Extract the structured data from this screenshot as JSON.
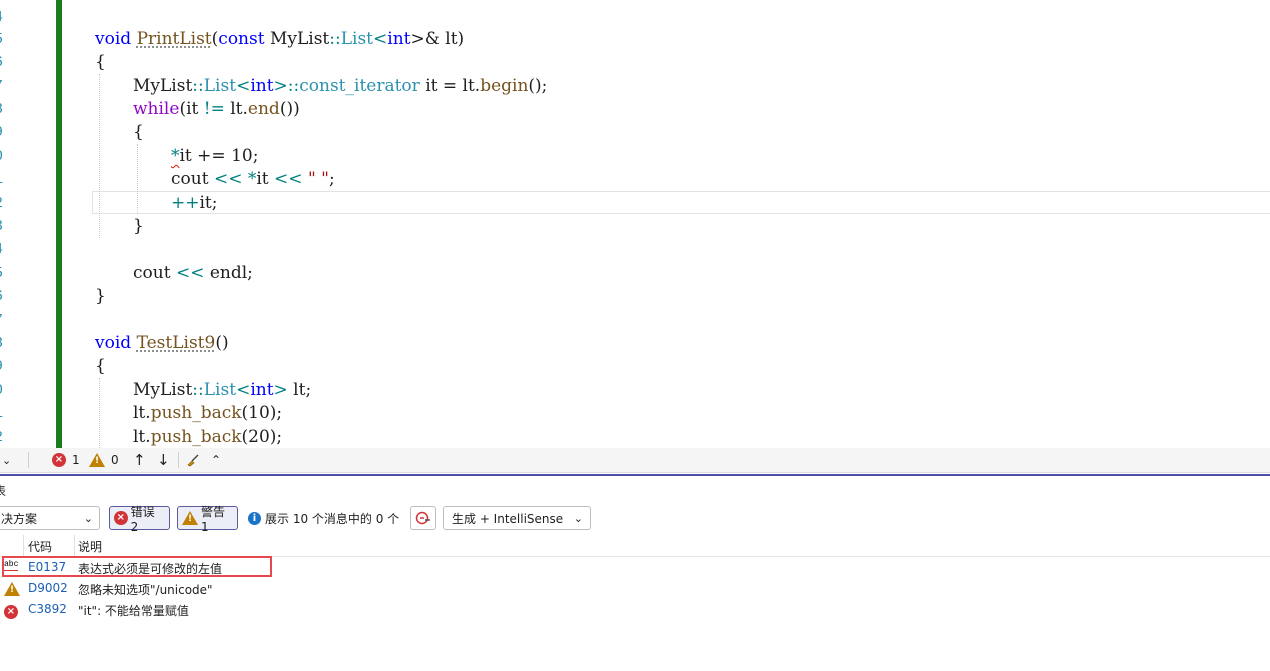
{
  "editor": {
    "line_numbers": [
      "4",
      "5",
      "6",
      "7",
      "8",
      "9",
      "0",
      "1",
      "2",
      "3",
      "4",
      "5",
      "6",
      "7",
      "8",
      "9",
      "0",
      "1",
      "2"
    ],
    "code": {
      "l1": [
        "void",
        " ",
        "PrintList",
        "(",
        "const",
        " MyList",
        "::",
        "List",
        "<",
        "int",
        ">& lt)"
      ],
      "l2": "{",
      "l3": [
        "MyList",
        "::",
        "List",
        "<",
        "int",
        ">",
        "::",
        "const_iterator",
        " it = lt.",
        "begin",
        "();"
      ],
      "l4": [
        "while",
        "(it ",
        "!=",
        " lt.",
        "end",
        "())"
      ],
      "l5": "{",
      "l6": [
        "*",
        "it += 10;"
      ],
      "l7": [
        "cout ",
        "<<",
        " ",
        "*",
        "it ",
        "<<",
        " ",
        "\" \"",
        ";"
      ],
      "l8": [
        "++",
        "it;"
      ],
      "l9": "}",
      "l10": [
        "cout ",
        "<<",
        " endl;"
      ],
      "l11": "}",
      "l12": [
        "void",
        " ",
        "TestList9",
        "()"
      ],
      "l13": "{",
      "l14": [
        "MyList",
        "::",
        "List",
        "<",
        "int",
        ">",
        " lt;"
      ],
      "l15": [
        "lt.",
        "push_back",
        "(10);"
      ],
      "l16": [
        "lt.",
        "push_back",
        "(20);"
      ]
    }
  },
  "statusbar": {
    "errors": "1",
    "warnings": "0",
    "up_icon": "arrow-up-icon",
    "down_icon": "arrow-down-icon",
    "broom_icon": "broom-icon",
    "caret_icon": "caret-up-icon"
  },
  "panel": {
    "title": "表",
    "scope_select": "决方案",
    "errors_btn": "错误 2",
    "warnings_btn": "警告 1",
    "messages_btn": "展示 10 个消息中的 0 个",
    "build_select": "生成 + IntelliSense"
  },
  "grid": {
    "columns": [
      "代码",
      "说明"
    ],
    "rows": [
      {
        "icon": "intellisense-abc-icon",
        "code": "E0137",
        "description": "表达式必须是可修改的左值"
      },
      {
        "icon": "warning-icon",
        "code": "D9002",
        "description": "忽略未知选项\"/unicode\""
      },
      {
        "icon": "error-icon",
        "code": "C3892",
        "description": "\"it\": 不能给常量赋值"
      }
    ]
  },
  "colors": {
    "change_bar": "#1e7a1e",
    "keyword": "#0000ff",
    "type": "#2b91af",
    "error": "#d13438",
    "warning": "#c08000",
    "highlight": "#e5484d"
  }
}
